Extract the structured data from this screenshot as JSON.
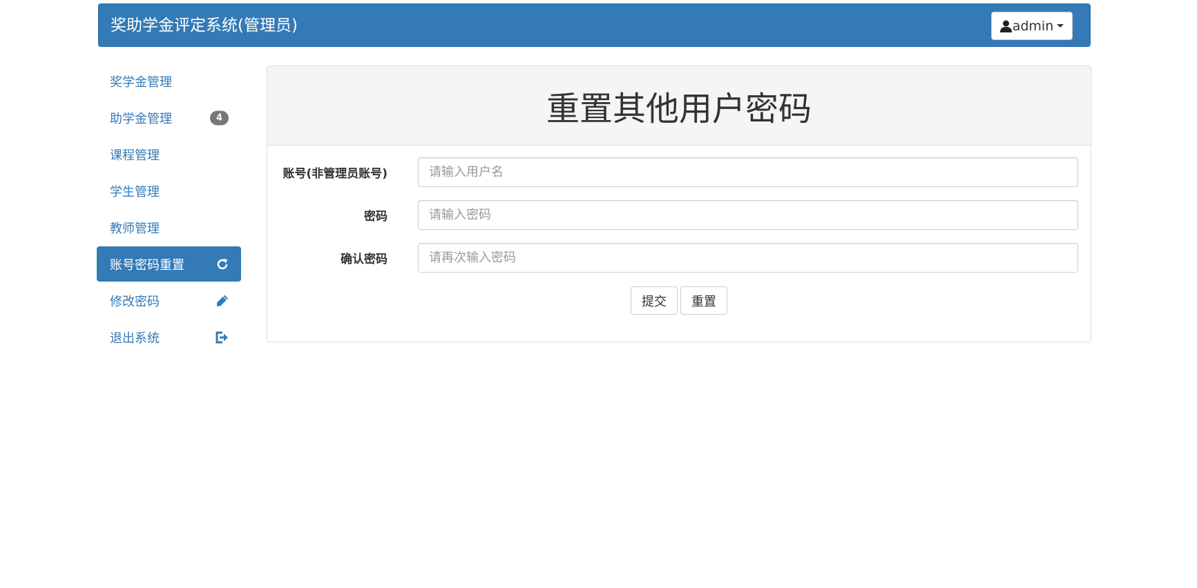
{
  "header": {
    "brand": "奖助学金评定系统(管理员)",
    "user_menu_label": "admin",
    "colors": {
      "brand_bg": "#337ab7"
    }
  },
  "sidebar": {
    "items": [
      {
        "label": "奖学金管理",
        "active": false
      },
      {
        "label": "助学金管理",
        "badge": "4",
        "active": false
      },
      {
        "label": "课程管理",
        "active": false
      },
      {
        "label": "学生管理",
        "active": false
      },
      {
        "label": "教师管理",
        "active": false
      },
      {
        "label": "账号密码重置",
        "icon": "refresh-icon",
        "active": true
      },
      {
        "label": "修改密码",
        "icon": "pencil-icon",
        "active": false
      },
      {
        "label": "退出系统",
        "icon": "logout-icon",
        "active": false
      }
    ]
  },
  "main": {
    "title": "重置其他用户密码",
    "form": {
      "account": {
        "label": "账号(非管理员账号)",
        "placeholder": "请输入用户名",
        "value": ""
      },
      "password": {
        "label": "密码",
        "placeholder": "请输入密码",
        "value": ""
      },
      "confirm": {
        "label": "确认密码",
        "placeholder": "请再次输入密码",
        "value": ""
      },
      "submit_label": "提交",
      "reset_label": "重置"
    }
  }
}
